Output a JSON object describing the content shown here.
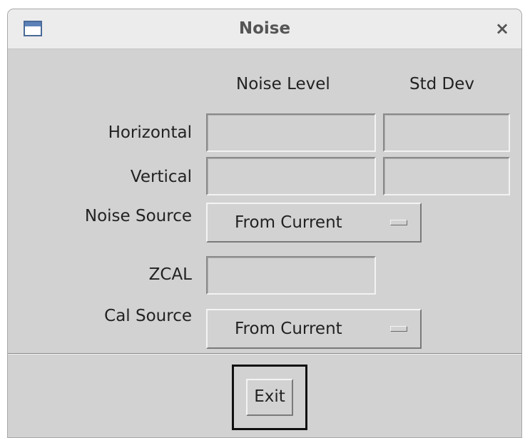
{
  "window": {
    "title": "Noise",
    "close_glyph": "×",
    "app_icon": "window-icon"
  },
  "columns": {
    "noise_level": "Noise Level",
    "std_dev": "Std Dev"
  },
  "rows": {
    "horizontal": {
      "label": "Horizontal",
      "noise_level": "",
      "std_dev": ""
    },
    "vertical": {
      "label": "Vertical",
      "noise_level": "",
      "std_dev": ""
    }
  },
  "noise_source": {
    "label": "Noise Source",
    "selected": "From Current"
  },
  "zcal": {
    "label": "ZCAL",
    "value": ""
  },
  "cal_source": {
    "label": "Cal Source",
    "selected": "From Current"
  },
  "footer": {
    "exit_label": "Exit"
  }
}
